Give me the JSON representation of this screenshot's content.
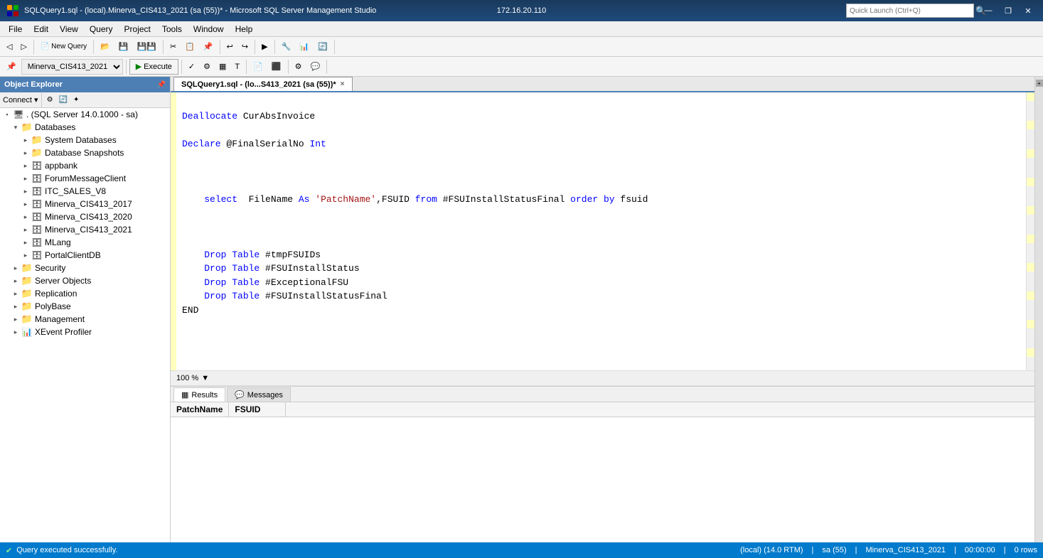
{
  "titleBar": {
    "title": "SQLQuery1.sql - (local).Minerva_CIS413_2021 (sa (55))* - Microsoft SQL Server Management Studio",
    "centerTitle": "172.16.20.110",
    "quickLaunch": "Quick Launch (Ctrl+Q)"
  },
  "menuBar": {
    "items": [
      "File",
      "Edit",
      "View",
      "Query",
      "Project",
      "Tools",
      "Window",
      "Help"
    ]
  },
  "toolbar1": {
    "dbDropdown": "Minerva_CIS413_2021",
    "executeLabel": "Execute",
    "buttons": [
      "new-query",
      "open",
      "save",
      "undo",
      "redo"
    ]
  },
  "objectExplorer": {
    "title": "Object Explorer",
    "connectLabel": "Connect",
    "serverNode": ". (SQL Server 14.0.1000 - sa)",
    "tree": [
      {
        "id": "databases",
        "label": "Databases",
        "level": 1,
        "expanded": true,
        "type": "folder"
      },
      {
        "id": "system-databases",
        "label": "System Databases",
        "level": 2,
        "expanded": false,
        "type": "folder"
      },
      {
        "id": "db-snapshots",
        "label": "Database Snapshots",
        "level": 2,
        "expanded": false,
        "type": "folder"
      },
      {
        "id": "appbank",
        "label": "appbank",
        "level": 2,
        "expanded": false,
        "type": "db"
      },
      {
        "id": "forum-msg",
        "label": "ForumMessageClient",
        "level": 2,
        "expanded": false,
        "type": "db"
      },
      {
        "id": "itc-sales",
        "label": "ITC_SALES_V8",
        "level": 2,
        "expanded": false,
        "type": "db"
      },
      {
        "id": "minerva-2017",
        "label": "Minerva_CIS413_2017",
        "level": 2,
        "expanded": false,
        "type": "db"
      },
      {
        "id": "minerva-2020",
        "label": "Minerva_CIS413_2020",
        "level": 2,
        "expanded": false,
        "type": "db"
      },
      {
        "id": "minerva-2021",
        "label": "Minerva_CIS413_2021",
        "level": 2,
        "expanded": false,
        "type": "db"
      },
      {
        "id": "mlang",
        "label": "MLang",
        "level": 2,
        "expanded": false,
        "type": "db"
      },
      {
        "id": "portal-client",
        "label": "PortalClientDB",
        "level": 2,
        "expanded": false,
        "type": "db"
      },
      {
        "id": "security",
        "label": "Security",
        "level": 1,
        "expanded": false,
        "type": "folder"
      },
      {
        "id": "server-objects",
        "label": "Server Objects",
        "level": 1,
        "expanded": false,
        "type": "folder"
      },
      {
        "id": "replication",
        "label": "Replication",
        "level": 1,
        "expanded": false,
        "type": "folder"
      },
      {
        "id": "polybase",
        "label": "PolyBase",
        "level": 1,
        "expanded": false,
        "type": "folder"
      },
      {
        "id": "management",
        "label": "Management",
        "level": 1,
        "expanded": false,
        "type": "folder"
      },
      {
        "id": "xevent",
        "label": "XEvent Profiler",
        "level": 1,
        "expanded": false,
        "type": "folder"
      }
    ]
  },
  "editorTab": {
    "label": "SQLQuery1.sql - (lo...S413_2021 (sa (55))*",
    "closeLabel": "×"
  },
  "codeLines": [
    {
      "tokens": [
        {
          "type": "kw",
          "text": "Deallocate"
        },
        {
          "type": "var",
          "text": " CurAbsInvoice"
        }
      ]
    },
    {
      "tokens": []
    },
    {
      "tokens": [
        {
          "type": "kw",
          "text": "Declare"
        },
        {
          "type": "var",
          "text": " @FinalSerialNo "
        },
        {
          "type": "kw",
          "text": "Int"
        }
      ]
    },
    {
      "tokens": []
    },
    {
      "tokens": []
    },
    {
      "tokens": []
    },
    {
      "tokens": [
        {
          "type": "var",
          "text": "    "
        },
        {
          "type": "kw",
          "text": "select"
        },
        {
          "type": "var",
          "text": "  FileName "
        },
        {
          "type": "kw",
          "text": "As"
        },
        {
          "type": "var",
          "text": " "
        },
        {
          "type": "str",
          "text": "'PatchName'"
        },
        {
          "type": "var",
          "text": ",FSUID "
        },
        {
          "type": "kw",
          "text": "from"
        },
        {
          "type": "var",
          "text": " #FSUInstallStatusFinal "
        },
        {
          "type": "kw",
          "text": "order by"
        },
        {
          "type": "var",
          "text": " fsuid"
        }
      ]
    },
    {
      "tokens": []
    },
    {
      "tokens": []
    },
    {
      "tokens": [
        {
          "type": "var",
          "text": "    "
        },
        {
          "type": "kw",
          "text": "Drop Table"
        },
        {
          "type": "var",
          "text": " #tmpFSUIDs"
        }
      ]
    },
    {
      "tokens": [
        {
          "type": "var",
          "text": "    "
        },
        {
          "type": "kw",
          "text": "Drop Table"
        },
        {
          "type": "var",
          "text": " #FSUInstallStatus"
        }
      ]
    },
    {
      "tokens": [
        {
          "type": "var",
          "text": "    "
        },
        {
          "type": "kw",
          "text": "Drop Table"
        },
        {
          "type": "var",
          "text": " #ExceptionalFSU"
        }
      ]
    },
    {
      "tokens": [
        {
          "type": "var",
          "text": "    "
        },
        {
          "type": "kw",
          "text": "Drop Table"
        },
        {
          "type": "var",
          "text": " #FSUInstallStatusFinal"
        }
      ]
    },
    {
      "tokens": [
        {
          "type": "var",
          "text": "END"
        }
      ]
    }
  ],
  "zoomBar": {
    "zoom": "100 %",
    "arrow": "▼"
  },
  "resultsTabs": [
    {
      "id": "results",
      "label": "Results",
      "icon": "grid"
    },
    {
      "id": "messages",
      "label": "Messages",
      "icon": "msg"
    }
  ],
  "resultsGrid": {
    "columns": [
      "PatchName",
      "FSUID"
    ],
    "rows": []
  },
  "statusBar": {
    "queryStatus": "Query executed successfully.",
    "server": "(local) (14.0 RTM)",
    "user": "sa (55)",
    "database": "Minerva_CIS413_2021",
    "time": "00:00:00",
    "rows": "0 rows"
  }
}
